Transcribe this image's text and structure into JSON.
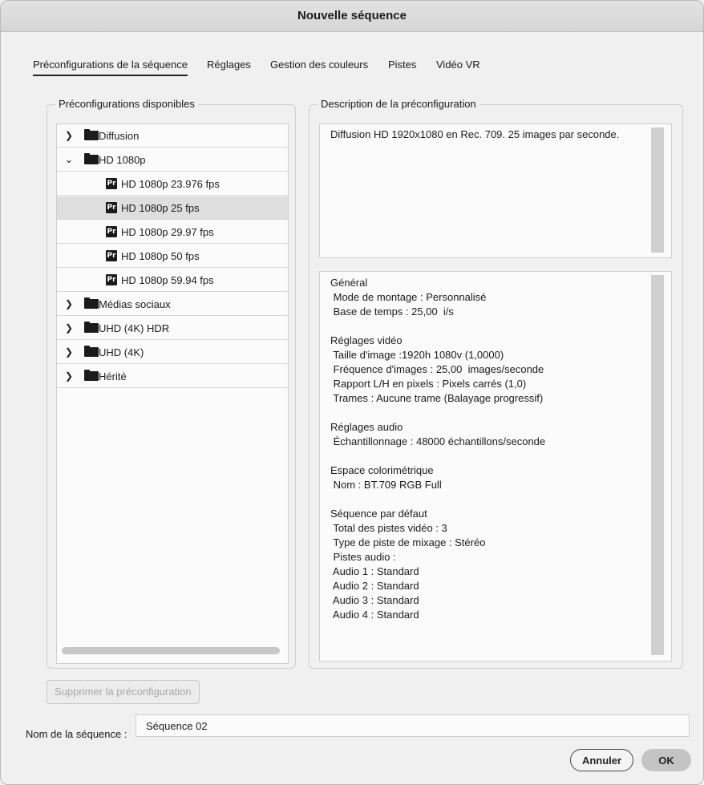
{
  "window": {
    "title": "Nouvelle séquence"
  },
  "tabs": [
    {
      "label": "Préconfigurations de la séquence",
      "active": true
    },
    {
      "label": "Réglages"
    },
    {
      "label": "Gestion des couleurs"
    },
    {
      "label": "Pistes"
    },
    {
      "label": "Vidéo VR"
    }
  ],
  "presets": {
    "title": "Préconfigurations disponibles",
    "items": [
      {
        "label": "Diffusion",
        "type": "folder",
        "expanded": false
      },
      {
        "label": "HD 1080p",
        "type": "folder",
        "expanded": true
      },
      {
        "label": "HD 1080p 23.976 fps",
        "type": "preset"
      },
      {
        "label": "HD 1080p 25 fps",
        "type": "preset",
        "selected": true
      },
      {
        "label": "HD 1080p 29.97 fps",
        "type": "preset"
      },
      {
        "label": "HD 1080p 50 fps",
        "type": "preset"
      },
      {
        "label": "HD 1080p 59.94 fps",
        "type": "preset"
      },
      {
        "label": "Médias sociaux",
        "type": "folder",
        "expanded": false
      },
      {
        "label": "UHD (4K) HDR",
        "type": "folder",
        "expanded": false
      },
      {
        "label": "UHD (4K)",
        "type": "folder",
        "expanded": false
      },
      {
        "label": "Hérité",
        "type": "folder",
        "expanded": false
      }
    ]
  },
  "description": {
    "title": "Description de la préconfiguration",
    "text": "Diffusion HD 1920x1080 en Rec. 709. 25 images par seconde.",
    "details": [
      "Général",
      " Mode de montage : Personnalisé",
      " Base de temps : 25,00  i/s",
      "",
      "Réglages vidéo",
      " Taille d'image :1920h 1080v (1,0000)",
      " Fréquence d'images : 25,00  images/seconde",
      " Rapport L/H en pixels : Pixels carrés (1,0)",
      " Trames : Aucune trame (Balayage progressif)",
      "",
      "Réglages audio",
      " Échantillonnage : 48000 échantillons/seconde",
      "",
      "Espace colorimétrique",
      " Nom : BT.709 RGB Full",
      "",
      "Séquence par défaut",
      " Total des pistes vidéo : 3",
      " Type de piste de mixage : Stéréo",
      " Pistes audio :",
      " Audio 1 : Standard",
      " Audio 2 : Standard",
      " Audio 3 : Standard",
      " Audio 4 : Standard"
    ]
  },
  "buttons": {
    "delete_preset": "Supprimer la préconfiguration",
    "cancel": "Annuler",
    "ok": "OK"
  },
  "sequence_name": {
    "label": "Nom de la séquence :",
    "value": "Séquence 02"
  },
  "icons": {
    "collapsed": "chevron-right-icon",
    "expanded": "chevron-down-icon",
    "folder": "folder-icon",
    "preset": "premiere-preset-icon"
  }
}
